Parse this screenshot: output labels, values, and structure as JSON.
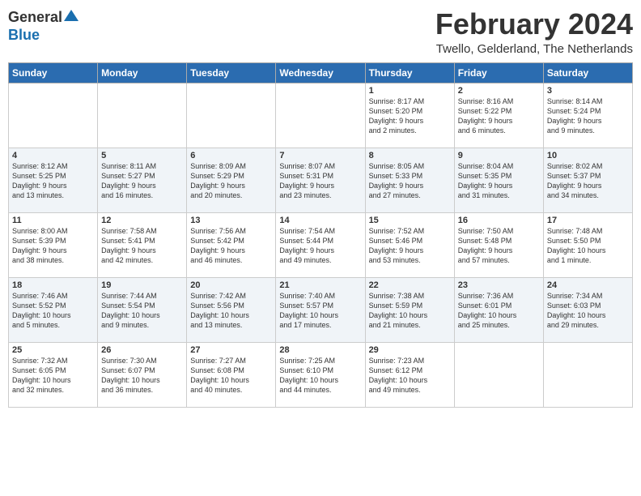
{
  "header": {
    "logo_general": "General",
    "logo_blue": "Blue",
    "month": "February 2024",
    "location": "Twello, Gelderland, The Netherlands"
  },
  "days_of_week": [
    "Sunday",
    "Monday",
    "Tuesday",
    "Wednesday",
    "Thursday",
    "Friday",
    "Saturday"
  ],
  "weeks": [
    [
      {
        "day": "",
        "text": ""
      },
      {
        "day": "",
        "text": ""
      },
      {
        "day": "",
        "text": ""
      },
      {
        "day": "",
        "text": ""
      },
      {
        "day": "1",
        "text": "Sunrise: 8:17 AM\nSunset: 5:20 PM\nDaylight: 9 hours\nand 2 minutes."
      },
      {
        "day": "2",
        "text": "Sunrise: 8:16 AM\nSunset: 5:22 PM\nDaylight: 9 hours\nand 6 minutes."
      },
      {
        "day": "3",
        "text": "Sunrise: 8:14 AM\nSunset: 5:24 PM\nDaylight: 9 hours\nand 9 minutes."
      }
    ],
    [
      {
        "day": "4",
        "text": "Sunrise: 8:12 AM\nSunset: 5:25 PM\nDaylight: 9 hours\nand 13 minutes."
      },
      {
        "day": "5",
        "text": "Sunrise: 8:11 AM\nSunset: 5:27 PM\nDaylight: 9 hours\nand 16 minutes."
      },
      {
        "day": "6",
        "text": "Sunrise: 8:09 AM\nSunset: 5:29 PM\nDaylight: 9 hours\nand 20 minutes."
      },
      {
        "day": "7",
        "text": "Sunrise: 8:07 AM\nSunset: 5:31 PM\nDaylight: 9 hours\nand 23 minutes."
      },
      {
        "day": "8",
        "text": "Sunrise: 8:05 AM\nSunset: 5:33 PM\nDaylight: 9 hours\nand 27 minutes."
      },
      {
        "day": "9",
        "text": "Sunrise: 8:04 AM\nSunset: 5:35 PM\nDaylight: 9 hours\nand 31 minutes."
      },
      {
        "day": "10",
        "text": "Sunrise: 8:02 AM\nSunset: 5:37 PM\nDaylight: 9 hours\nand 34 minutes."
      }
    ],
    [
      {
        "day": "11",
        "text": "Sunrise: 8:00 AM\nSunset: 5:39 PM\nDaylight: 9 hours\nand 38 minutes."
      },
      {
        "day": "12",
        "text": "Sunrise: 7:58 AM\nSunset: 5:41 PM\nDaylight: 9 hours\nand 42 minutes."
      },
      {
        "day": "13",
        "text": "Sunrise: 7:56 AM\nSunset: 5:42 PM\nDaylight: 9 hours\nand 46 minutes."
      },
      {
        "day": "14",
        "text": "Sunrise: 7:54 AM\nSunset: 5:44 PM\nDaylight: 9 hours\nand 49 minutes."
      },
      {
        "day": "15",
        "text": "Sunrise: 7:52 AM\nSunset: 5:46 PM\nDaylight: 9 hours\nand 53 minutes."
      },
      {
        "day": "16",
        "text": "Sunrise: 7:50 AM\nSunset: 5:48 PM\nDaylight: 9 hours\nand 57 minutes."
      },
      {
        "day": "17",
        "text": "Sunrise: 7:48 AM\nSunset: 5:50 PM\nDaylight: 10 hours\nand 1 minute."
      }
    ],
    [
      {
        "day": "18",
        "text": "Sunrise: 7:46 AM\nSunset: 5:52 PM\nDaylight: 10 hours\nand 5 minutes."
      },
      {
        "day": "19",
        "text": "Sunrise: 7:44 AM\nSunset: 5:54 PM\nDaylight: 10 hours\nand 9 minutes."
      },
      {
        "day": "20",
        "text": "Sunrise: 7:42 AM\nSunset: 5:56 PM\nDaylight: 10 hours\nand 13 minutes."
      },
      {
        "day": "21",
        "text": "Sunrise: 7:40 AM\nSunset: 5:57 PM\nDaylight: 10 hours\nand 17 minutes."
      },
      {
        "day": "22",
        "text": "Sunrise: 7:38 AM\nSunset: 5:59 PM\nDaylight: 10 hours\nand 21 minutes."
      },
      {
        "day": "23",
        "text": "Sunrise: 7:36 AM\nSunset: 6:01 PM\nDaylight: 10 hours\nand 25 minutes."
      },
      {
        "day": "24",
        "text": "Sunrise: 7:34 AM\nSunset: 6:03 PM\nDaylight: 10 hours\nand 29 minutes."
      }
    ],
    [
      {
        "day": "25",
        "text": "Sunrise: 7:32 AM\nSunset: 6:05 PM\nDaylight: 10 hours\nand 32 minutes."
      },
      {
        "day": "26",
        "text": "Sunrise: 7:30 AM\nSunset: 6:07 PM\nDaylight: 10 hours\nand 36 minutes."
      },
      {
        "day": "27",
        "text": "Sunrise: 7:27 AM\nSunset: 6:08 PM\nDaylight: 10 hours\nand 40 minutes."
      },
      {
        "day": "28",
        "text": "Sunrise: 7:25 AM\nSunset: 6:10 PM\nDaylight: 10 hours\nand 44 minutes."
      },
      {
        "day": "29",
        "text": "Sunrise: 7:23 AM\nSunset: 6:12 PM\nDaylight: 10 hours\nand 49 minutes."
      },
      {
        "day": "",
        "text": ""
      },
      {
        "day": "",
        "text": ""
      }
    ]
  ]
}
